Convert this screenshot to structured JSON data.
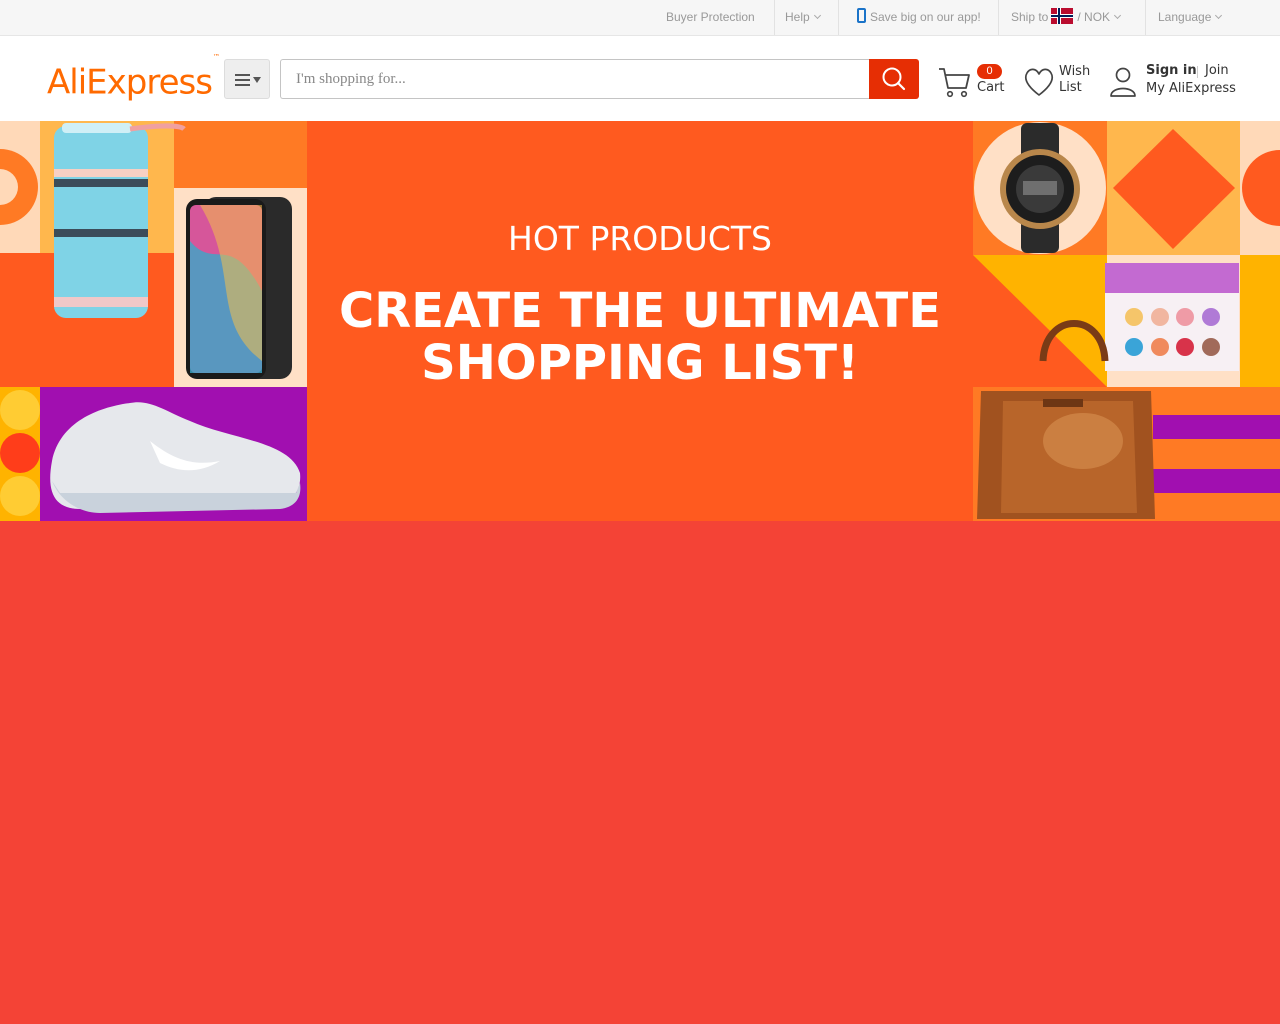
{
  "topbar": {
    "buyer_protection": "Buyer Protection",
    "help": "Help",
    "app_promo": "Save big on our app!",
    "ship_to": "Ship to",
    "currency_sep": "/",
    "currency": "NOK",
    "language": "Language"
  },
  "header": {
    "logo": "AliExpress",
    "logo_tm": "™",
    "search_placeholder": "I'm shopping for...",
    "cart_count": "0",
    "cart_label": "Cart",
    "wish_line1": "Wish",
    "wish_line2": "List",
    "sign_in": "Sign in",
    "join": "Join",
    "my_account": "My AliExpress"
  },
  "banner": {
    "subtitle": "HOT PRODUCTS",
    "title_line1": "CREATE THE ULTIMATE",
    "title_line2": "SHOPPING LIST!",
    "product_image_labels": [
      "lunch box",
      "smartphone",
      "sneaker",
      "watch",
      "eyeshadow palette",
      "handbag"
    ]
  },
  "colors": {
    "brand_orange": "#ff6a00",
    "search_red": "#e62e04",
    "banner_orange": "#ff5a1f",
    "page_red": "#f44336"
  }
}
